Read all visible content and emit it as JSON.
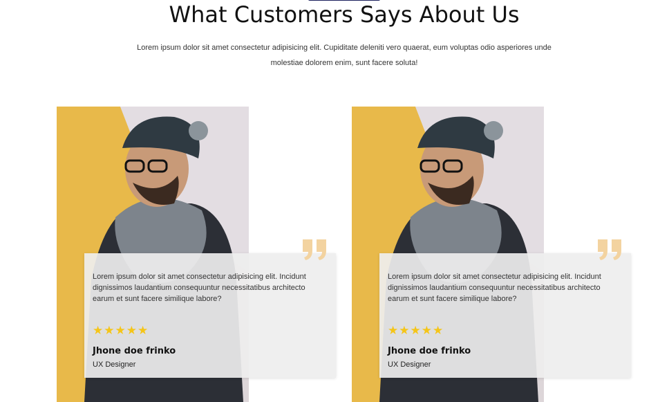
{
  "section": {
    "title": "What Customers Says About Us",
    "subtitle": "Lorem ipsum dolor sit amet consectetur adipisicing elit. Cupiditate deleniti vero quaerat, eum voluptas odio asperiores unde molestiae dolorem enim, sunt facere soluta!"
  },
  "testimonials": [
    {
      "text": "Lorem ipsum dolor sit amet consectetur adipisicing elit. Incidunt dignissimos laudantium consequuntur necessitatibus architecto earum et sunt facere similique labore?",
      "stars": "★★★★★",
      "rating": 5,
      "name": "Jhone doe frinko",
      "role": "UX Designer"
    },
    {
      "text": "Lorem ipsum dolor sit amet consectetur adipisicing elit. Incidunt dignissimos laudantium consequuntur necessitatibus architecto earum et sunt facere similique labore?",
      "stars": "★★★★★",
      "rating": 5,
      "name": "Jhone doe frinko",
      "role": "UX Designer"
    }
  ],
  "colors": {
    "accent": "#1a1f5c",
    "star": "#f5c518",
    "quote_mark": "#f3d3a0",
    "photo_yellow": "#e8b94a"
  },
  "icons": {
    "quote": "quote-icon",
    "star": "star-icon"
  }
}
